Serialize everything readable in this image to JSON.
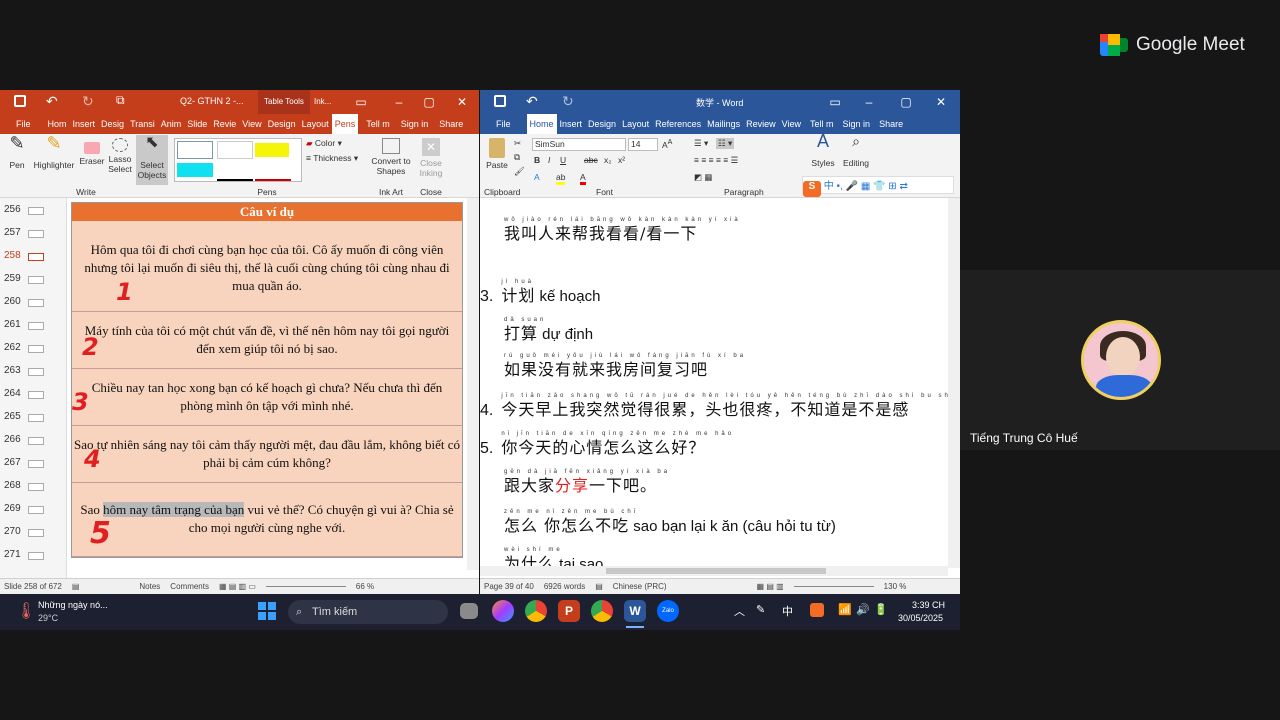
{
  "meet": {
    "brand": "Google Meet",
    "participant_name": "Tiếng Trung Cô Huế"
  },
  "ppt": {
    "file_title": "Q2- GTHN 2 -...",
    "context_tab": "Table Tools",
    "ink_tab": "Ink...",
    "tabs": [
      "File",
      "Hom",
      "Insert",
      "Desig",
      "Transi",
      "Anim",
      "Slide",
      "Revie",
      "View",
      "Design",
      "Layout",
      "Pens"
    ],
    "tell_me": "Tell m",
    "sign_in": "Sign in",
    "share": "Share",
    "tools": {
      "pen": "Pen",
      "highlighter": "Highlighter",
      "eraser": "Eraser",
      "lasso": "Lasso Select",
      "select": "Select Objects",
      "color": "Color",
      "thickness": "Thickness",
      "convert": "Convert to Shapes",
      "close_ink": "Close Inking"
    },
    "groups": {
      "write": "Write",
      "pens": "Pens",
      "ink_art": "Ink Art",
      "close": "Close"
    },
    "thumb_numbers": [
      "256",
      "257",
      "258",
      "259",
      "260",
      "261",
      "262",
      "263",
      "264",
      "265",
      "266",
      "267",
      "268",
      "269",
      "270",
      "271"
    ],
    "current_slide": "258",
    "slide_header": "Câu ví dụ",
    "rows": [
      {
        "text": "Hôm qua tôi đi chơi cùng bạn học của tôi. Cô ấy muốn đi công viên nhưng tôi lại muốn đi siêu thị, thế là cuối cùng chúng tôi cùng nhau đi mua quần áo.",
        "num": "1"
      },
      {
        "text": "Máy tính của tôi có một chút vấn đề, vì thế nên hôm nay tôi gọi người đến xem giúp tôi nó bị sao.",
        "num": "2"
      },
      {
        "text": "Chiều nay tan học xong bạn có kế hoạch gì chưa? Nếu chưa thì đến phòng mình ôn tập với mình nhé.",
        "num": "3"
      },
      {
        "text": "Sao tự nhiên sáng nay tôi cảm thấy người mệt, đau đầu lắm, không biết có phải bị cảm cúm không?",
        "num": "4"
      }
    ],
    "row5": {
      "pre": "Sao ",
      "hl": "hôm nay tâm trạng của bạn",
      "post": " vui vẻ thế? Có chuyện gì vui à? Chia sẻ cho mọi người cùng nghe với.",
      "num": "5"
    },
    "status": {
      "slide_of": "Slide 258 of 672",
      "notes": "Notes",
      "comments": "Comments",
      "zoom": "66 %"
    }
  },
  "word": {
    "title": "数学 - Word",
    "tabs": [
      "File",
      "Home",
      "Insert",
      "Design",
      "Layout",
      "References",
      "Mailings",
      "Review",
      "View"
    ],
    "tell_me": "Tell m",
    "sign_in": "Sign in",
    "share": "Share",
    "font_name": "SimSun",
    "font_size": "14",
    "groups": {
      "clipboard": "Clipboard",
      "font": "Font",
      "paragraph": "Paragraph",
      "styles": "Styles"
    },
    "paste": "Paste",
    "styles_btn": "Styles",
    "editing_btn": "Editing",
    "lines": [
      {
        "py": "wǒ jiào rén lái bāng wǒ kàn kàn kàn yí xià",
        "zh": "我叫人来帮我看看/看一下",
        "vn": ""
      },
      {
        "num": "3.",
        "py": "jì huà",
        "zh": "计划",
        "vn": " kế hoạch"
      },
      {
        "py": "dǎ suan",
        "zh": "打算",
        "vn": " dự định"
      },
      {
        "py": "rú guǒ méi yǒu jiù lái wǒ fáng jiān fù xí ba",
        "zh": "如果没有就来我房间复习吧",
        "vn": ""
      },
      {
        "num": "4.",
        "py": "jīn tiān zǎo shang wǒ tū rán jué de hěn lèi tóu yě hěn téng bù zhī dào shì bu shì gǎn",
        "zh": "今天早上我突然觉得很累，头也很疼，不知道是不是感",
        "vn": ""
      },
      {
        "num": "5.",
        "py": "nǐ jīn tiān de xīn qíng zěn me zhè me hǎo",
        "zh": "你今天的心情怎么这么好？",
        "vn": ""
      },
      {
        "py": "gēn dà jiā fēn xiǎng yí xià ba",
        "zh_pre": "跟大家",
        "zh_red": "分享",
        "zh_post": "一下吧。"
      },
      {
        "py": "zěn me   nǐ zěn me bù chī",
        "zh": "怎么   你怎么不吃",
        "vn": " sao bạn lại k ăn (câu hỏi tu từ)"
      },
      {
        "py": "wèi shí me",
        "zh": "为什么",
        "vn": " tại sao"
      }
    ],
    "status": {
      "page": "Page 39 of 40",
      "words": "6926 words",
      "lang": "Chinese (PRC)",
      "zoom": "130 %"
    }
  },
  "taskbar": {
    "weather_title": "Những ngày nó...",
    "temp": "29°C",
    "search": "Tìm kiếm",
    "time": "3:39 CH",
    "date": "30/05/2025",
    "ime": "中"
  }
}
